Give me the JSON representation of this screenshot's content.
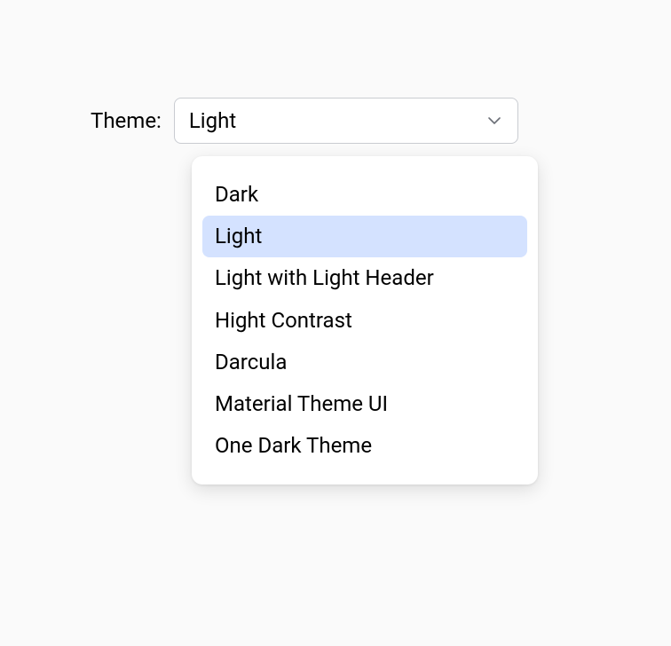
{
  "theme_selector": {
    "label": "Theme:",
    "selected": "Light",
    "options": [
      {
        "label": "Dark",
        "selected": false
      },
      {
        "label": "Light",
        "selected": true
      },
      {
        "label": "Light with Light Header",
        "selected": false
      },
      {
        "label": "Hight Contrast",
        "selected": false
      },
      {
        "label": "Darcula",
        "selected": false
      },
      {
        "label": "Material Theme UI",
        "selected": false
      },
      {
        "label": "One Dark Theme",
        "selected": false
      }
    ]
  }
}
